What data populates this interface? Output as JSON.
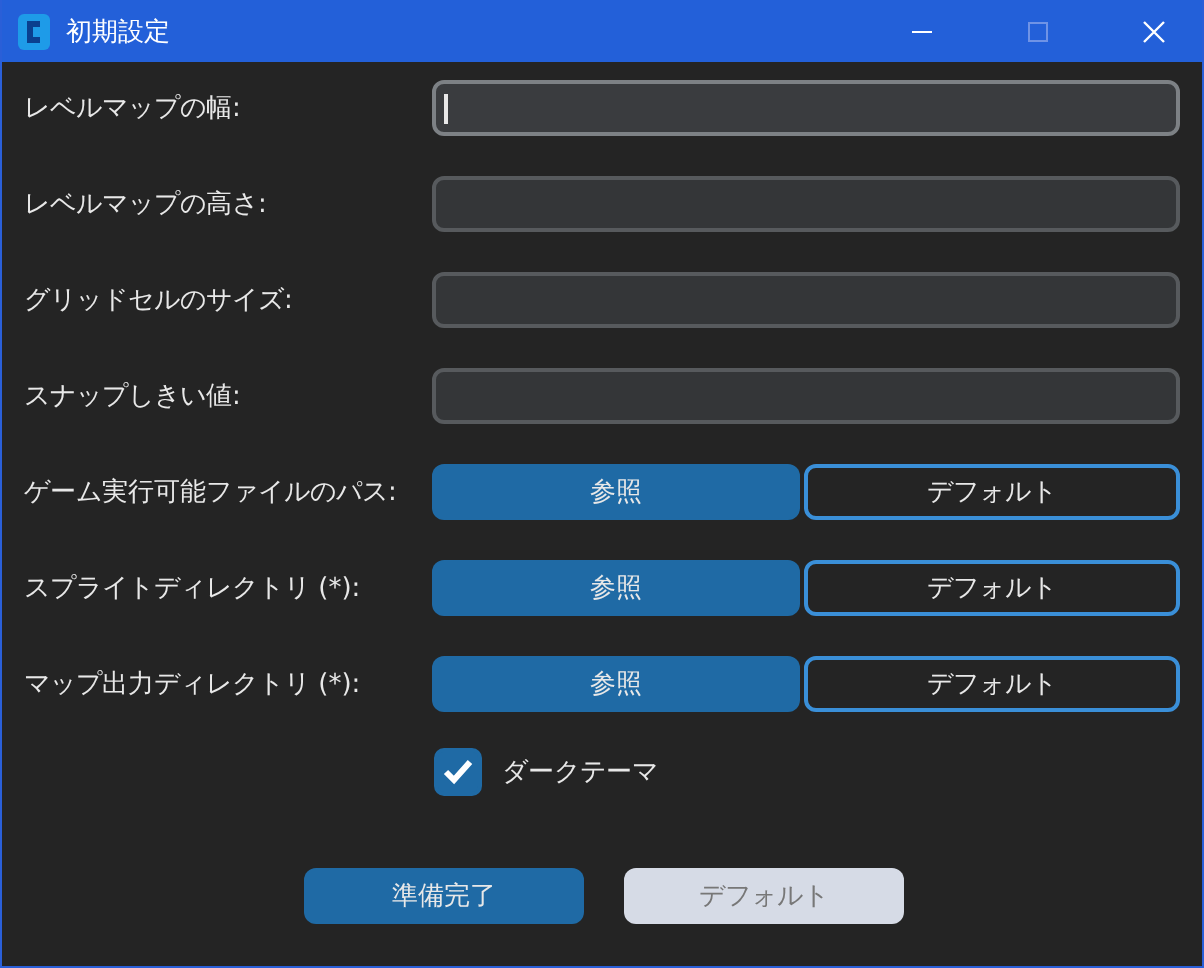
{
  "window": {
    "title": "初期設定"
  },
  "rows": [
    {
      "kind": "text",
      "label": "レベルマップの幅:",
      "focused": true
    },
    {
      "kind": "text",
      "label": "レベルマップの高さ:",
      "focused": false
    },
    {
      "kind": "text",
      "label": "グリッドセルのサイズ:",
      "focused": false
    },
    {
      "kind": "text",
      "label": "スナップしきい値:",
      "focused": false
    },
    {
      "kind": "path",
      "label": "ゲーム実行可能ファイルのパス:",
      "browse": "参照",
      "default": "デフォルト"
    },
    {
      "kind": "path",
      "label": "スプライトディレクトリ (*):",
      "browse": "参照",
      "default": "デフォルト"
    },
    {
      "kind": "path",
      "label": "マップ出力ディレクトリ (*):",
      "browse": "参照",
      "default": "デフォルト"
    }
  ],
  "dark_theme": {
    "label": "ダークテーマ",
    "checked": true
  },
  "buttons": [
    {
      "label": "準備完了",
      "kind": "primary"
    },
    {
      "label": "デフォルト",
      "kind": "secondary"
    }
  ]
}
